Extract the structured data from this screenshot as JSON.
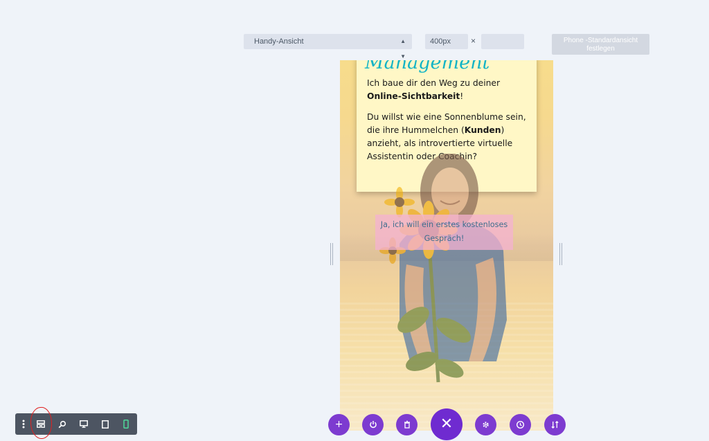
{
  "toolbar": {
    "view_select": "Handy-Ansicht",
    "width_value": "400px",
    "times": "×",
    "height_value": "",
    "default_button": "Phone -Standardansicht festlegen"
  },
  "preview": {
    "heading": "Management",
    "para1_prefix": "Ich baue dir den Weg zu deiner ",
    "para1_bold": "Online-Sichtbarkeit",
    "para1_suffix": "!",
    "para2_prefix": "Du willst wie eine Sonnenblume sein, die ihre Hummelchen (",
    "para2_bold": "Kunden",
    "para2_suffix": ") anzieht, als introvertierte virtuelle Assistentin oder Coachin?",
    "cta": "Ja, ich will ein erstes kostenloses Gespräch!"
  },
  "actions": {
    "add": "+",
    "power": "power-icon",
    "trash": "trash-icon",
    "close": "✕",
    "settings": "gear-icon",
    "history": "clock-icon",
    "sort": "sort-icon"
  },
  "viewbar": {
    "items": [
      "more-icon",
      "wireframe-icon",
      "zoom-icon",
      "desktop-icon",
      "tablet-icon",
      "phone-icon"
    ]
  },
  "colors": {
    "accent_purple": "#7d3bd0",
    "heading_teal": "#12b4c6",
    "cta_pink": "#f4b2d2",
    "annotation_red": "#e02020",
    "phone_active_green": "#4fd99a"
  }
}
